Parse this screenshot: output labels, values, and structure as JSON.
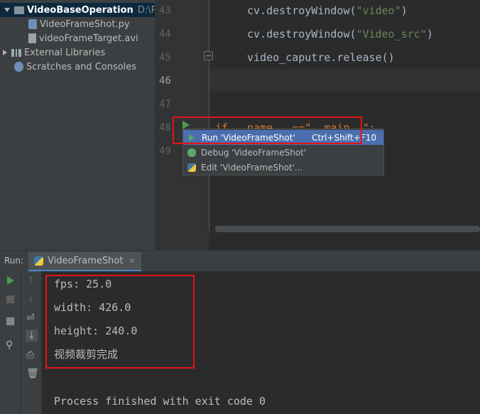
{
  "project_tree": {
    "root": {
      "name": "VideoBaseOperation",
      "path": "D:\\Prog"
    },
    "files": [
      "VideoFrameShot.py",
      "videoFrameTarget.avi"
    ],
    "external_libraries": "External Libraries",
    "scratches": "Scratches and Consoles"
  },
  "editor": {
    "lines": [
      {
        "num": "43",
        "code": "cv.destroyWindow(",
        "str": "\"video\"",
        "tail": ")"
      },
      {
        "num": "44",
        "code": "cv.destroyWindow(",
        "str": "\"Video_src\"",
        "tail": ")"
      },
      {
        "num": "45",
        "code": "video_caputre.release()",
        "str": "",
        "tail": ""
      },
      {
        "num": "46",
        "code": "",
        "str": "",
        "tail": ""
      },
      {
        "num": "47",
        "code": "",
        "str": "",
        "tail": ""
      },
      {
        "num": "48",
        "code": "if __name__ ==\"__main__\":",
        "str": "",
        "tail": ""
      },
      {
        "num": "49",
        "code": "",
        "str": "",
        "tail": ""
      }
    ]
  },
  "context_menu": {
    "items": [
      {
        "label": "Run 'VideoFrameShot'",
        "shortcut": "Ctrl+Shift+F10"
      },
      {
        "label": "Debug 'VideoFrameShot'",
        "shortcut": ""
      },
      {
        "label": "Edit 'VideoFrameShot'...",
        "shortcut": ""
      }
    ]
  },
  "run_window": {
    "label": "Run:",
    "tab": "VideoFrameShot",
    "output": [
      "fps: 25.0",
      "width: 426.0",
      "height: 240.0",
      "视频裁剪完成"
    ],
    "exit_message": "Process finished with exit code 0"
  },
  "colors": {
    "highlight_box": "#e51313",
    "menu_selected": "#4b6eaf",
    "run_green": "#499c54"
  }
}
